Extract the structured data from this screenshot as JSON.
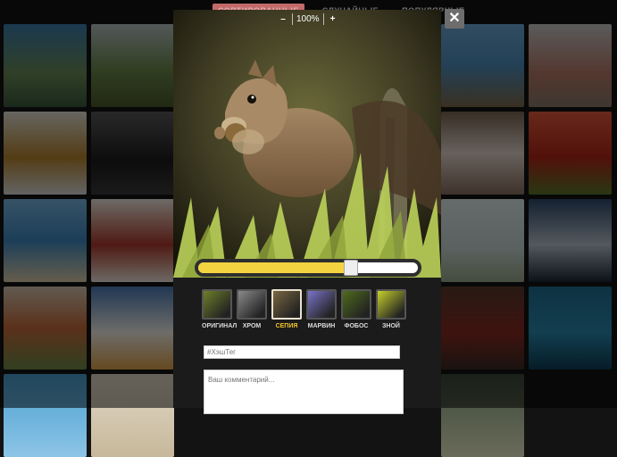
{
  "nav": {
    "items": [
      "СОРТИРОВАННЫЕ",
      "СЛУЧАЙНЫЕ",
      "ПОПУЛЯРНЫЕ"
    ],
    "active_index": 0
  },
  "viewer": {
    "close_label": "✕",
    "zoom_minus": "–",
    "zoom_value": "100%",
    "zoom_plus": "+",
    "photo_subject": "squirrel eating nut",
    "slider_level": 0.69,
    "filters": [
      {
        "label": "ОРИГИНАЛ",
        "color": "#6d7f2a"
      },
      {
        "label": "ХРОМ",
        "color": "#8b8b8b"
      },
      {
        "label": "СЕПИЯ",
        "color": "#7a6642"
      },
      {
        "label": "МАРВИН",
        "color": "#7a73c8"
      },
      {
        "label": "ФОБОС",
        "color": "#4f6b1c"
      },
      {
        "label": "ЗНОЙ",
        "color": "#c7d12c"
      }
    ],
    "selected_filter": 2,
    "hashtag_placeholder": "#ХэшТег",
    "comment_placeholder": "Ваш комментарий..."
  },
  "colors": {
    "accent": "#f3d340",
    "selected_filter_label": "#f2c32b",
    "nav_active_bg": "#c26a6a"
  }
}
